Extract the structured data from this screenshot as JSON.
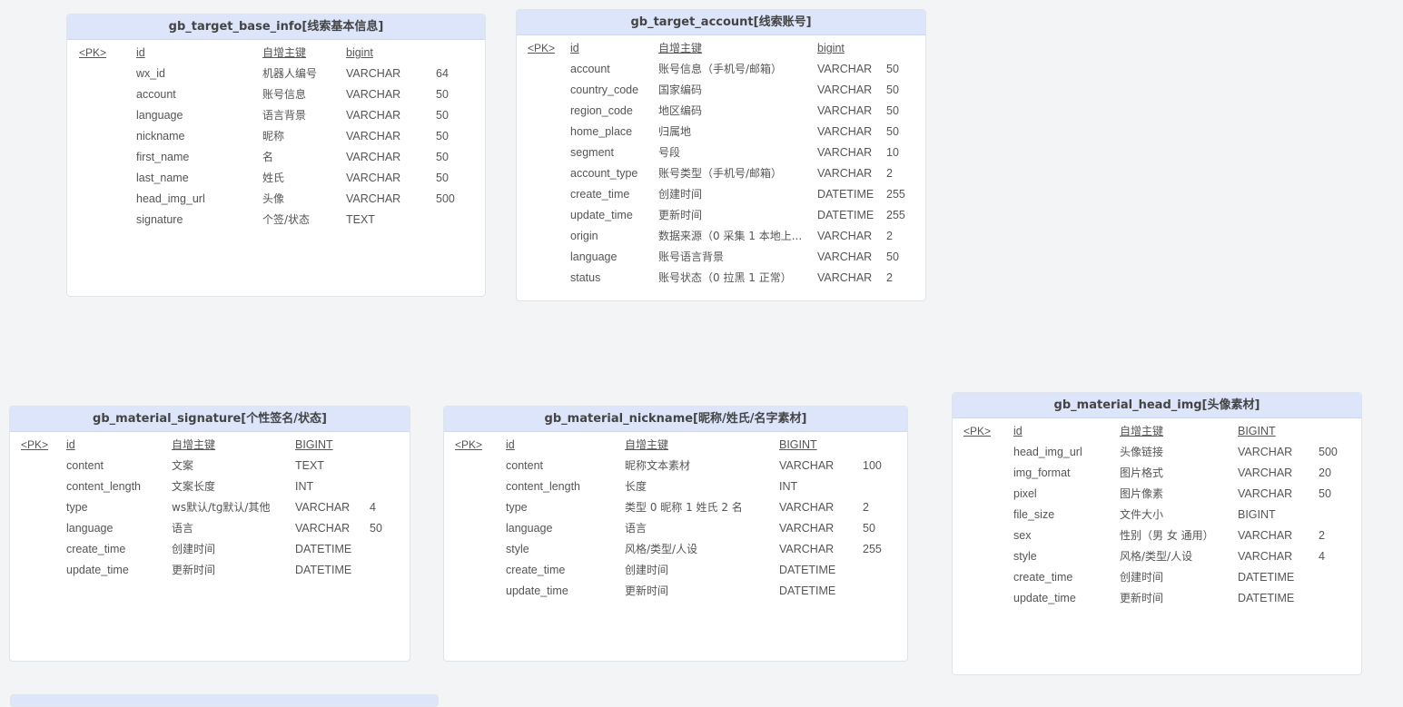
{
  "pk_label": "<PK>",
  "tables": [
    {
      "name": "gb_target_base_info[线索基本信息]",
      "rows": [
        {
          "pk": true,
          "field": "id",
          "comment": "自增主键",
          "type": "bigint",
          "len": ""
        },
        {
          "field": "wx_id",
          "comment": "机器人编号",
          "type": "VARCHAR",
          "len": "64"
        },
        {
          "field": "account",
          "comment": "账号信息",
          "type": "VARCHAR",
          "len": "50"
        },
        {
          "field": "language",
          "comment": "语言背景",
          "type": "VARCHAR",
          "len": "50"
        },
        {
          "field": "nickname",
          "comment": "昵称",
          "type": "VARCHAR",
          "len": "50"
        },
        {
          "field": "first_name",
          "comment": "名",
          "type": "VARCHAR",
          "len": "50"
        },
        {
          "field": "last_name",
          "comment": "姓氏",
          "type": "VARCHAR",
          "len": "50"
        },
        {
          "field": "head_img_url",
          "comment": "头像",
          "type": "VARCHAR",
          "len": "500"
        },
        {
          "field": "signature",
          "comment": "个签/状态",
          "type": "TEXT",
          "len": ""
        }
      ]
    },
    {
      "name": "gb_target_account[线索账号]",
      "rows": [
        {
          "pk": true,
          "field": "id",
          "comment": "自增主键",
          "type": "bigint",
          "len": ""
        },
        {
          "field": "account",
          "comment": "账号信息（手机号/邮箱）",
          "type": "VARCHAR",
          "len": "50"
        },
        {
          "field": "country_code",
          "comment": "国家编码",
          "type": "VARCHAR",
          "len": "50"
        },
        {
          "field": "region_code",
          "comment": "地区编码",
          "type": "VARCHAR",
          "len": "50"
        },
        {
          "field": "home_place",
          "comment": "归属地",
          "type": "VARCHAR",
          "len": "50"
        },
        {
          "field": "segment",
          "comment": "号段",
          "type": "VARCHAR",
          "len": "10"
        },
        {
          "field": "account_type",
          "comment": "账号类型（手机号/邮箱）",
          "type": "VARCHAR",
          "len": "2"
        },
        {
          "field": "create_time",
          "comment": "创建时间",
          "type": "DATETIME",
          "len": "255"
        },
        {
          "field": "update_time",
          "comment": "更新时间",
          "type": "DATETIME",
          "len": "255"
        },
        {
          "field": "origin",
          "comment": "数据来源（0 采集 1 本地上...",
          "type": "VARCHAR",
          "len": "2"
        },
        {
          "field": "language",
          "comment": "账号语言背景",
          "type": "VARCHAR",
          "len": "50"
        },
        {
          "field": "status",
          "comment": "账号状态（0 拉黑 1 正常）",
          "type": "VARCHAR",
          "len": "2"
        }
      ]
    },
    {
      "name": "gb_material_signature[个性签名/状态]",
      "rows": [
        {
          "pk": true,
          "field": "id",
          "comment": "自增主键",
          "type": "BIGINT",
          "len": ""
        },
        {
          "field": "content",
          "comment": "文案",
          "type": "TEXT",
          "len": ""
        },
        {
          "field": "content_length",
          "comment": "文案长度",
          "type": "INT",
          "len": ""
        },
        {
          "field": "type",
          "comment": "ws默认/tg默认/其他",
          "type": "VARCHAR",
          "len": "4"
        },
        {
          "field": "language",
          "comment": "语言",
          "type": "VARCHAR",
          "len": "50"
        },
        {
          "field": "create_time",
          "comment": "创建时间",
          "type": "DATETIME",
          "len": ""
        },
        {
          "field": "update_time",
          "comment": "更新时间",
          "type": "DATETIME",
          "len": ""
        }
      ]
    },
    {
      "name": "gb_material_nickname[昵称/姓氏/名字素材]",
      "rows": [
        {
          "pk": true,
          "field": "id",
          "comment": "自增主键",
          "type": "BIGINT",
          "len": ""
        },
        {
          "field": "content",
          "comment": "昵称文本素材",
          "type": "VARCHAR",
          "len": "100"
        },
        {
          "field": "content_length",
          "comment": "长度",
          "type": "INT",
          "len": ""
        },
        {
          "field": "type",
          "comment": "类型 0 昵称 1 姓氏 2 名",
          "type": "VARCHAR",
          "len": "2"
        },
        {
          "field": "language",
          "comment": "语言",
          "type": "VARCHAR",
          "len": "50"
        },
        {
          "field": "style",
          "comment": "风格/类型/人设",
          "type": "VARCHAR",
          "len": "255"
        },
        {
          "field": "create_time",
          "comment": "创建时间",
          "type": "DATETIME",
          "len": ""
        },
        {
          "field": "update_time",
          "comment": "更新时间",
          "type": "DATETIME",
          "len": ""
        }
      ]
    },
    {
      "name": "gb_material_head_img[头像素材]",
      "rows": [
        {
          "pk": true,
          "field": "id",
          "comment": "自增主键",
          "type": "BIGINT",
          "len": ""
        },
        {
          "field": "head_img_url",
          "comment": "头像链接",
          "type": "VARCHAR",
          "len": "500"
        },
        {
          "field": "img_format",
          "comment": "图片格式",
          "type": "VARCHAR",
          "len": "20"
        },
        {
          "field": "pixel",
          "comment": "图片像素",
          "type": "VARCHAR",
          "len": "50"
        },
        {
          "field": "file_size",
          "comment": "文件大小",
          "type": "BIGINT",
          "len": ""
        },
        {
          "field": "sex",
          "comment": "性别（男 女 通用）",
          "type": "VARCHAR",
          "len": "2"
        },
        {
          "field": "style",
          "comment": "风格/类型/人设",
          "type": "VARCHAR",
          "len": "4"
        },
        {
          "field": "create_time",
          "comment": "创建时间",
          "type": "DATETIME",
          "len": ""
        },
        {
          "field": "update_time",
          "comment": "更新时间",
          "type": "DATETIME",
          "len": ""
        }
      ]
    }
  ]
}
